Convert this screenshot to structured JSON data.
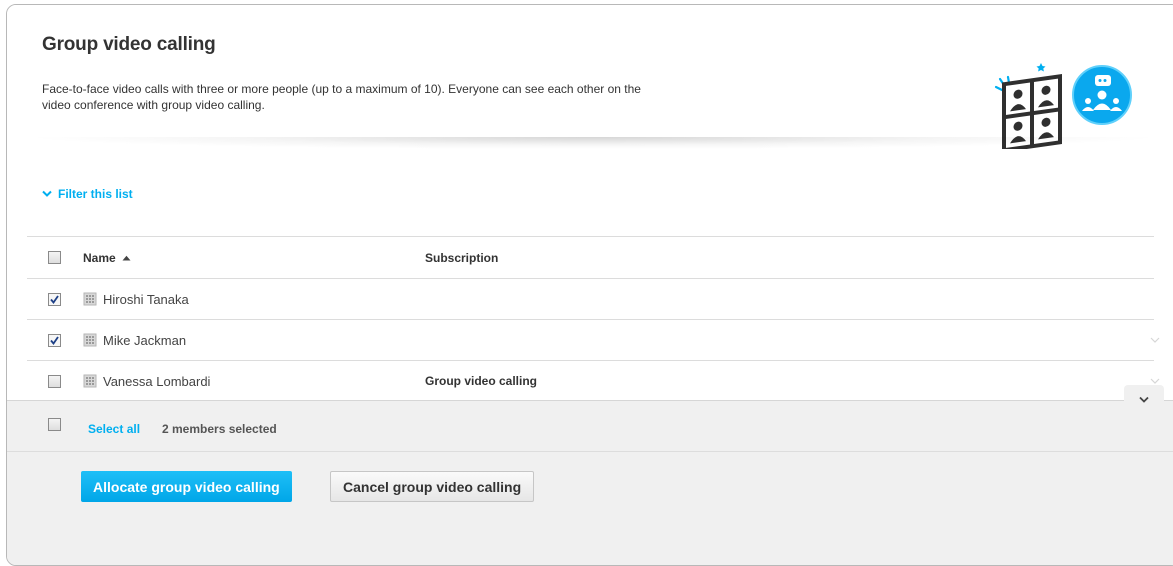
{
  "header": {
    "title": "Group video calling",
    "description": "Face-to-face video calls with three or more people (up to a maximum of 10). Everyone can see each other on the video conference with group video calling."
  },
  "filter": {
    "label": "Filter this list"
  },
  "table": {
    "columns": {
      "name": "Name",
      "subscription": "Subscription"
    },
    "sort": {
      "column": "name",
      "direction": "ascending"
    },
    "rows": [
      {
        "name": "Hiroshi Tanaka",
        "subscription": "",
        "checked": true
      },
      {
        "name": "Mike Jackman",
        "subscription": "",
        "checked": true
      },
      {
        "name": "Vanessa Lombardi",
        "subscription": "Group video calling",
        "checked": false
      }
    ]
  },
  "footer": {
    "select_all": "Select all",
    "selected_count": "2 members selected",
    "allocate_button": "Allocate group video calling",
    "cancel_button": "Cancel group video calling"
  },
  "colors": {
    "accent": "#00aff0",
    "footer_bg": "#f0f0f0",
    "text": "#333333"
  },
  "icons": {
    "hero": "group-video-call-icon",
    "row": "building-icon",
    "sort": "sort-ascending-icon",
    "filter": "chevron-down-icon"
  }
}
